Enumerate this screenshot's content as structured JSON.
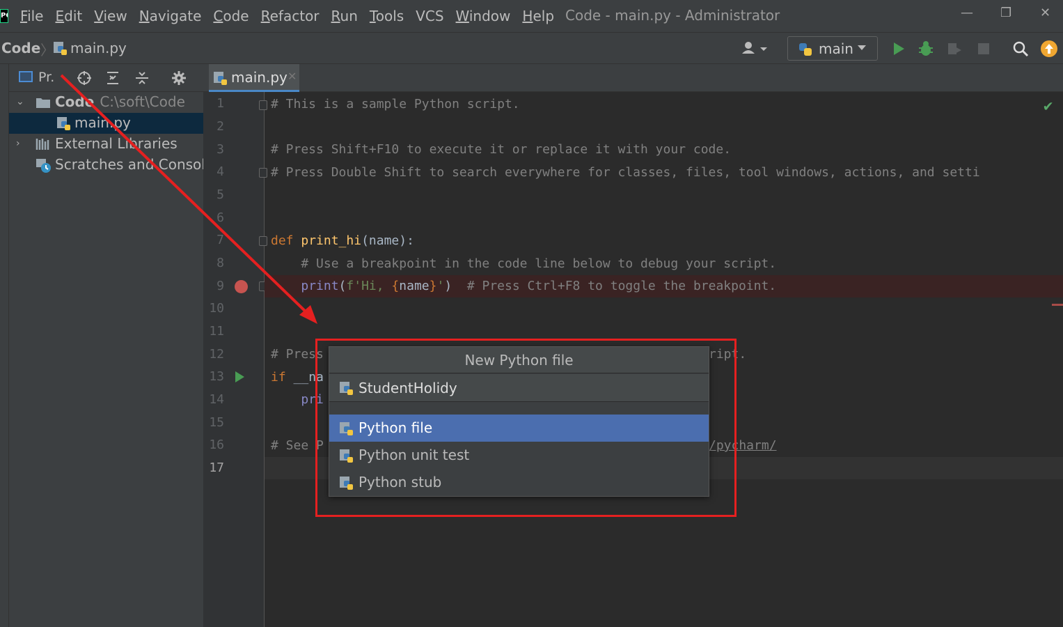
{
  "menubar": {
    "items": [
      {
        "mnemonic": "F",
        "rest": "ile"
      },
      {
        "mnemonic": "E",
        "rest": "dit"
      },
      {
        "mnemonic": "V",
        "rest": "iew"
      },
      {
        "mnemonic": "N",
        "rest": "avigate"
      },
      {
        "mnemonic": "C",
        "rest": "ode"
      },
      {
        "mnemonic": "R",
        "rest": "efactor"
      },
      {
        "mnemonic": "R",
        "rest": "un"
      },
      {
        "mnemonic": "T",
        "rest": "ools"
      },
      {
        "mnemonic": "V",
        "rest": "CS"
      },
      {
        "mnemonic": "W",
        "rest": "indow"
      },
      {
        "mnemonic": "H",
        "rest": "elp"
      }
    ],
    "window_title": "Code - main.py - Administrator"
  },
  "navbar": {
    "root": "Code",
    "file": "main.py",
    "run_config": "main"
  },
  "project": {
    "title": "Pr.",
    "tree": [
      {
        "label": "Code",
        "path": "C:\\soft\\Code"
      },
      {
        "label": "main.py"
      },
      {
        "label": "External Libraries"
      },
      {
        "label": "Scratches and Consoles"
      }
    ]
  },
  "editor": {
    "tab": "main.py",
    "line_numbers": [
      "1",
      "2",
      "3",
      "4",
      "5",
      "6",
      "7",
      "8",
      "9",
      "10",
      "11",
      "12",
      "13",
      "14",
      "15",
      "16",
      "17"
    ],
    "lines": {
      "l1": "# This is a sample Python script.",
      "l3": "# Press Shift+F10 to execute it or replace it with your code.",
      "l4": "# Press Double Shift to search everywhere for classes, files, tool windows, actions, and setti",
      "l7_kw": "def",
      "l7_fn": "print_hi",
      "l7_rest": "(name):",
      "l8": "    # Use a breakpoint in the code line below to debug your script.",
      "l9_indent": "    ",
      "l9_bi": "print",
      "l9_open": "(",
      "l9_str1": "f'Hi, ",
      "l9_fb1": "{",
      "l9_var": "name",
      "l9_fb2": "}",
      "l9_str2": "'",
      "l9_close": ")",
      "l9_cm": "  # Press Ctrl+F8 to toggle the breakpoint.",
      "l12_left": "# Press",
      "l12_right": "ript.",
      "l13_kw": "if",
      "l13_rest": " __na",
      "l14": "    pri",
      "l16_left": "# See P",
      "l16_right": "/pycharm/"
    }
  },
  "popup": {
    "title": "New Python file",
    "input_value": "StudentHolidy",
    "items": [
      "Python file",
      "Python unit test",
      "Python stub"
    ]
  },
  "colors": {
    "accent_selection": "#4b6eaf",
    "annotation_red": "#e52020",
    "breakpoint": "#c75450",
    "run_green": "#499c54"
  }
}
